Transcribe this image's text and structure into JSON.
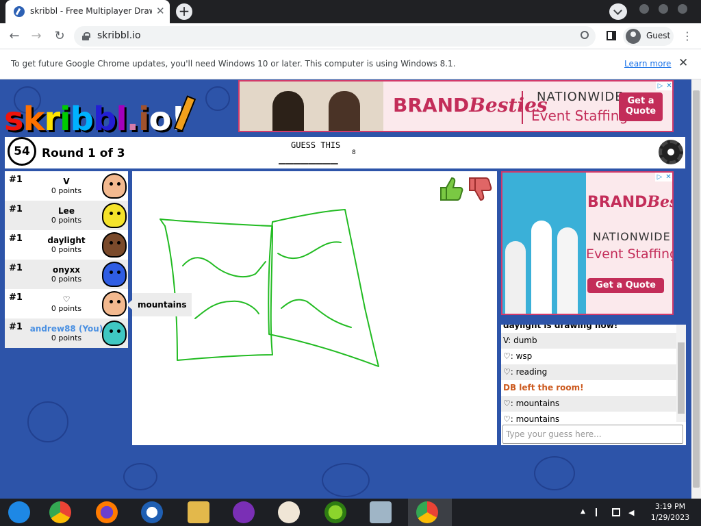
{
  "browser": {
    "tab_title": "skribbl - Free Multiplayer Drawing",
    "url": "skribbl.io",
    "profile_label": "Guest"
  },
  "infobar": {
    "message": "To get future Google Chrome updates, you'll need Windows 10 or later. This computer is using Windows 8.1.",
    "link": "Learn more"
  },
  "game": {
    "logo_letters": [
      "s",
      "k",
      "r",
      "i",
      "b",
      "b",
      "l",
      ".",
      "i",
      "o",
      "!"
    ],
    "timer": "54",
    "round": "Round 1 of 3",
    "guess_title": "GUESS THIS",
    "guess_blanks": "________",
    "guess_length": "8",
    "speech_bubble": "mountains",
    "players": [
      {
        "rank": "#1",
        "name": "V",
        "score": "0 points",
        "avatar_color": "#f3b98f"
      },
      {
        "rank": "#1",
        "name": "Lee",
        "score": "0 points",
        "avatar_color": "#f5e32a"
      },
      {
        "rank": "#1",
        "name": "daylight",
        "score": "0 points",
        "avatar_color": "#7a4a2b"
      },
      {
        "rank": "#1",
        "name": "onyxx",
        "score": "0 points",
        "avatar_color": "#2f5de3"
      },
      {
        "rank": "#1",
        "name": "♡",
        "score": "0 points",
        "avatar_color": "#f3b98f"
      },
      {
        "rank": "#1",
        "name": "andrew88 (You)",
        "score": "0 points",
        "avatar_color": "#3fc7c2"
      }
    ]
  },
  "ads": {
    "top": {
      "brand_a": "BRAND",
      "brand_b": "Besties",
      "line1": "NATIONWIDE",
      "line2": "Event Staffing",
      "cta": "Get a Quote"
    },
    "side": {
      "brand_a": "BRAND",
      "brand_b": "Besties",
      "line1": "NATIONWIDE",
      "line2": "Event Staffing",
      "cta": "Get a Quote"
    }
  },
  "chat": {
    "messages": [
      {
        "text": "daylight is drawing now!",
        "type": "partial"
      },
      {
        "text": "V: dumb",
        "type": "msg"
      },
      {
        "text": "♡: wsp",
        "type": "msg"
      },
      {
        "text": "♡: reading",
        "type": "msg"
      },
      {
        "text": "DB left the room!",
        "type": "sys"
      },
      {
        "text": "♡: mountains",
        "type": "msg"
      },
      {
        "text": "♡: mountains",
        "type": "msg"
      }
    ],
    "placeholder": "Type your guess here..."
  },
  "taskbar": {
    "time": "3:19 PM",
    "date": "1/29/2023"
  },
  "colors": {
    "page_bg": "#2d54a9",
    "drawing_stroke": "#22bb22",
    "system_message": "#cc5a1f",
    "you_name": "#4a90e2"
  }
}
